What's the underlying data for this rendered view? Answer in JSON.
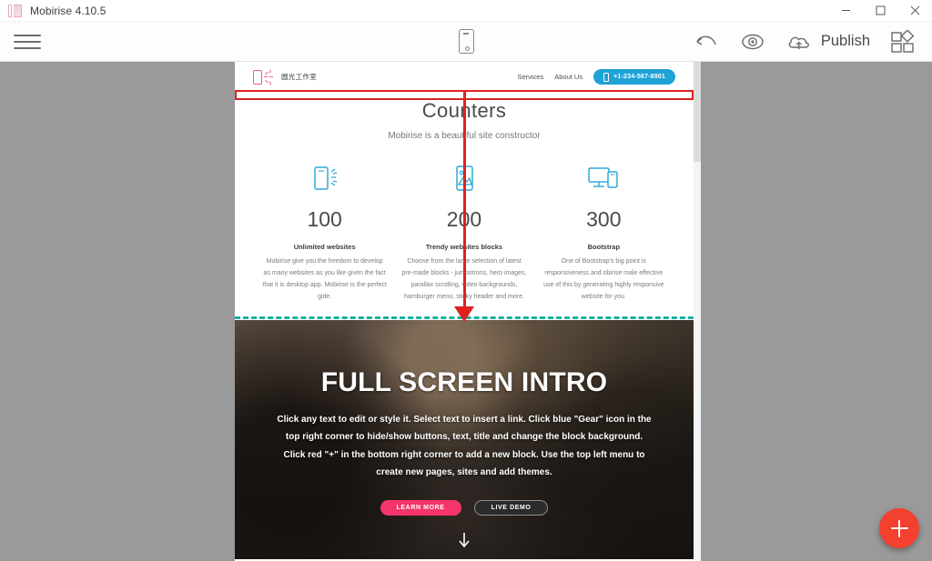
{
  "window": {
    "title": "Mobirise 4.10.5",
    "logo_icon": "mobirise-logo-icon",
    "minimize_icon": "minimize-icon",
    "maximize_icon": "maximize-icon",
    "close_icon": "close-icon"
  },
  "toolbar": {
    "menu_icon": "hamburger-menu-icon",
    "device_icon": "mobile-device-icon",
    "undo_icon": "undo-arrow-icon",
    "preview_icon": "eye-preview-icon",
    "publish_icon": "cloud-upload-icon",
    "publish_label": "Publish",
    "blocks_icon": "blocks-grid-icon"
  },
  "site": {
    "nav": {
      "logo_icon": "phone-sun-logo-icon",
      "brand": "圆光工作室",
      "links": [
        {
          "label": "Services"
        },
        {
          "label": "About Us"
        }
      ],
      "phone_icon": "phone-icon",
      "phone": "+1-234-567-8901"
    },
    "counters_block": {
      "title": "Counters",
      "subtitle": "Mobirise is a beautiful site constructor",
      "columns": [
        {
          "icon": "phone-sun-icon",
          "number": "100",
          "caption": "Unlimited websites",
          "description": "Mobirise give you the freedom to develop as many websites as you like given the fact that it is desktop app. Mobirise is the perfect gide."
        },
        {
          "icon": "phone-image-icon",
          "number": "200",
          "caption": "Trendy websites blocks",
          "description": "Choose from the large selection of latest pre-made blocks - jumbotrons, hero images, parallax scrolling, video backgrounds, hamburger menu, sticky header and more."
        },
        {
          "icon": "desktop-mobile-icon",
          "number": "300",
          "caption": "Bootstrap",
          "description": "One of Bootstrap's big point is responsiveness and obirise male effective use of this by generating highly responsive website for you."
        }
      ]
    },
    "hero_block": {
      "heading": "FULL SCREEN INTRO",
      "paragraph": "Click any text to edit or style it. Select text to insert a link. Click blue \"Gear\" icon in the top right corner to hide/show buttons, text, title and change the block background. Click red \"+\" in the bottom right corner to add a new block. Use the top left menu to create new pages, sites and add themes.",
      "buttons": [
        {
          "label": "LEARN MORE",
          "style": "primary"
        },
        {
          "label": "LIVE DEMO",
          "style": "ghost"
        }
      ],
      "scroll_icon": "scroll-down-arrow-icon"
    }
  },
  "editor": {
    "drop_indicator_icon": "block-drop-indicator",
    "drag_line_icon": "drag-guide-line",
    "drag_arrow_icon": "drag-arrow-down-icon",
    "selection_icon": "block-selection-outline",
    "add_block_icon": "plus-icon"
  },
  "colors": {
    "accent_red": "#e02020",
    "fab_red": "#f4402f",
    "drop_teal": "#16b3a0",
    "nav_blue": "#1fa2d6",
    "btn_pink": "#f4356b"
  }
}
